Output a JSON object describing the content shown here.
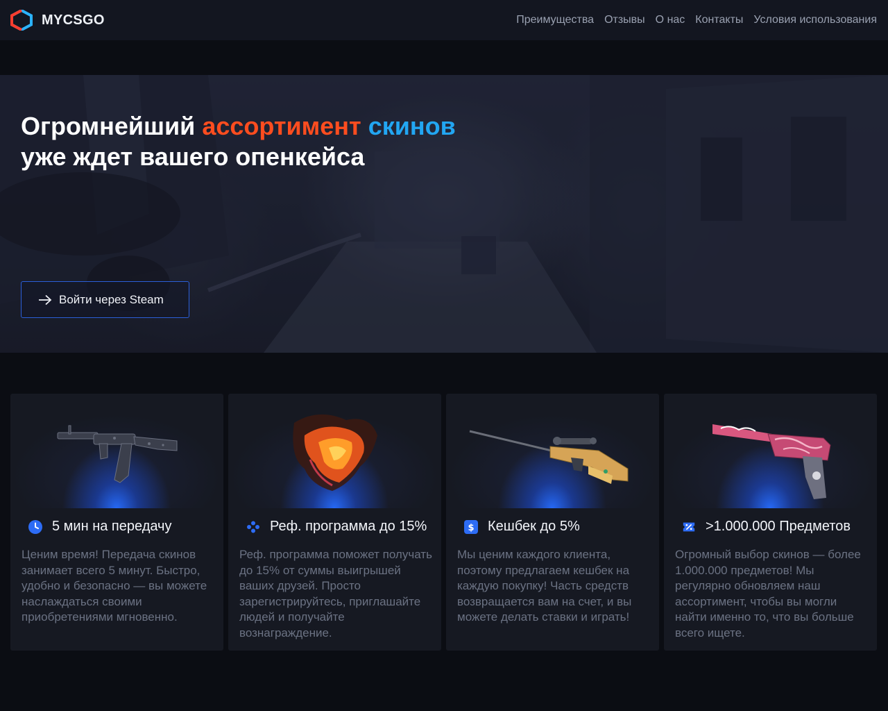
{
  "header": {
    "brand": "MYCSGO",
    "nav": [
      "Преимущества",
      "Отзывы",
      "О нас",
      "Контакты",
      "Условия использования"
    ]
  },
  "hero": {
    "title_part1": "Огромнейший ",
    "title_highlight1": "ассортимент",
    "title_space": " ",
    "title_highlight2": "скинов",
    "title_line2": "уже ждет вашего опенкейса",
    "steam_button": "Войти через Steam"
  },
  "cards": [
    {
      "title": "5 мин на передачу",
      "icon": "clock-icon",
      "text": "Ценим время! Передача скинов занимает всего 5 минут. Быстро, удобно и безопасно — вы можете наслаждаться своими приобретениями мгновенно."
    },
    {
      "title": "Реф. программа до 15%",
      "icon": "users-icon",
      "text": "Реф. программа поможет получать до 15% от суммы выигрышей ваших друзей. Просто зарегистрируйтесь, приглашайте людей и получайте вознаграждение."
    },
    {
      "title": "Кешбек до 5%",
      "icon": "dollar-icon",
      "text": "Мы ценим каждого клиента, поэтому предлагаем кешбек на каждую покупку! Часть средств возвращается вам на счет, и вы можете делать ставки и играть!"
    },
    {
      "title": ">1.000.000 Предметов",
      "icon": "percent-ticket-icon",
      "text": "Огромный выбор скинов — более 1.000.000 предметов! Мы регулярно обновляем наш ассортимент, чтобы вы могли найти именно то, что вы больше всего ищете."
    }
  ],
  "colors": {
    "accent_orange": "#ff4d1f",
    "accent_blue": "#22a6f2",
    "button_border": "#2b5fd9",
    "background": "#0b0d13",
    "card": "#161922"
  }
}
